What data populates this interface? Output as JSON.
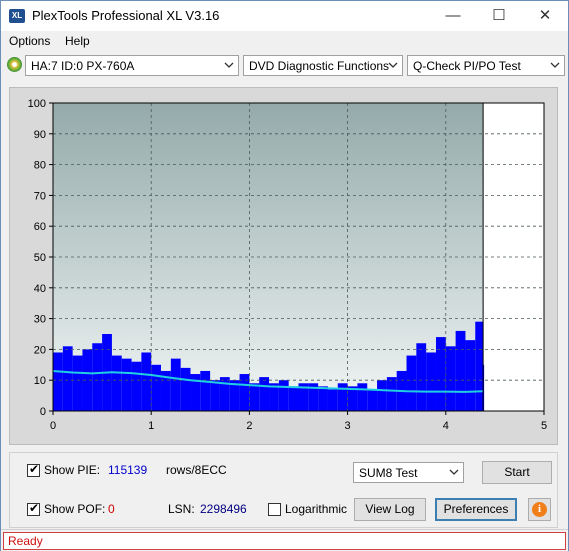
{
  "window": {
    "title": "PlexTools Professional XL V3.16",
    "icon_text": "XL",
    "controls": {
      "minimize": "—",
      "maximize": "☐",
      "close": "✕"
    }
  },
  "menu": {
    "items": [
      "Options",
      "Help"
    ]
  },
  "toolbar": {
    "drive": "HA:7 ID:0  PX-760A",
    "function": "DVD Diagnostic Functions",
    "test": "Q-Check PI/PO Test"
  },
  "chart_data": {
    "type": "bar",
    "title": "",
    "xlabel": "",
    "ylabel": "",
    "xlim": [
      0,
      5
    ],
    "ylim": [
      0,
      100
    ],
    "x_ticks": [
      0,
      1,
      2,
      3,
      4,
      5
    ],
    "y_ticks": [
      0,
      10,
      20,
      30,
      40,
      50,
      60,
      70,
      80,
      90,
      100
    ],
    "data_end_x": 4.38,
    "grid": true,
    "colors": {
      "bars": "#0000ff",
      "line": "#20d0e0",
      "plot_bg_top": "#94aaaa",
      "plot_bg_bottom": "#f2f6f6",
      "unused_bg": "#ffffff"
    },
    "series": [
      {
        "type": "bar",
        "x": [
          0.0,
          0.1,
          0.2,
          0.3,
          0.4,
          0.5,
          0.6,
          0.7,
          0.8,
          0.9,
          1.0,
          1.1,
          1.2,
          1.3,
          1.4,
          1.5,
          1.6,
          1.7,
          1.8,
          1.9,
          2.0,
          2.1,
          2.2,
          2.3,
          2.4,
          2.5,
          2.6,
          2.7,
          2.8,
          2.9,
          3.0,
          3.1,
          3.2,
          3.3,
          3.4,
          3.5,
          3.6,
          3.7,
          3.8,
          3.9,
          4.0,
          4.1,
          4.2,
          4.3,
          4.38
        ],
        "values": [
          19,
          21,
          18,
          20,
          22,
          25,
          18,
          17,
          16,
          19,
          15,
          13,
          17,
          14,
          12,
          13,
          10,
          11,
          10,
          12,
          9,
          11,
          9,
          10,
          8,
          9,
          9,
          8,
          7,
          9,
          8,
          9,
          7,
          10,
          11,
          13,
          18,
          22,
          19,
          24,
          21,
          26,
          23,
          29,
          15
        ]
      },
      {
        "type": "line",
        "x": [
          0.0,
          0.2,
          0.4,
          0.6,
          0.8,
          1.0,
          1.2,
          1.4,
          1.6,
          1.8,
          2.0,
          2.2,
          2.4,
          2.6,
          2.8,
          3.0,
          3.2,
          3.4,
          3.6,
          3.8,
          4.0,
          4.2,
          4.38
        ],
        "values": [
          13,
          12.5,
          12.2,
          12.6,
          12.3,
          11.7,
          10.8,
          10.0,
          9.4,
          8.8,
          8.4,
          8.0,
          7.8,
          7.6,
          7.4,
          7.2,
          7.0,
          6.7,
          6.4,
          6.3,
          6.3,
          6.2,
          6.4
        ]
      }
    ]
  },
  "bottom": {
    "show_pie_label": "Show PIE:",
    "pie_value": "115139",
    "pie_unit": "rows/8ECC",
    "show_pof_label": "Show POF:",
    "pof_value": "0",
    "lsn_label": "LSN:",
    "lsn_value": "2298496",
    "logarithmic_label": "Logarithmic",
    "test_select": "SUM8 Test",
    "start_button": "Start",
    "view_log_button": "View Log",
    "preferences_button": "Preferences",
    "info_icon": "info-icon",
    "info_glyph": "i",
    "show_pie_checked": true,
    "show_pof_checked": true,
    "logarithmic_checked": false
  },
  "status": {
    "text": "Ready"
  }
}
